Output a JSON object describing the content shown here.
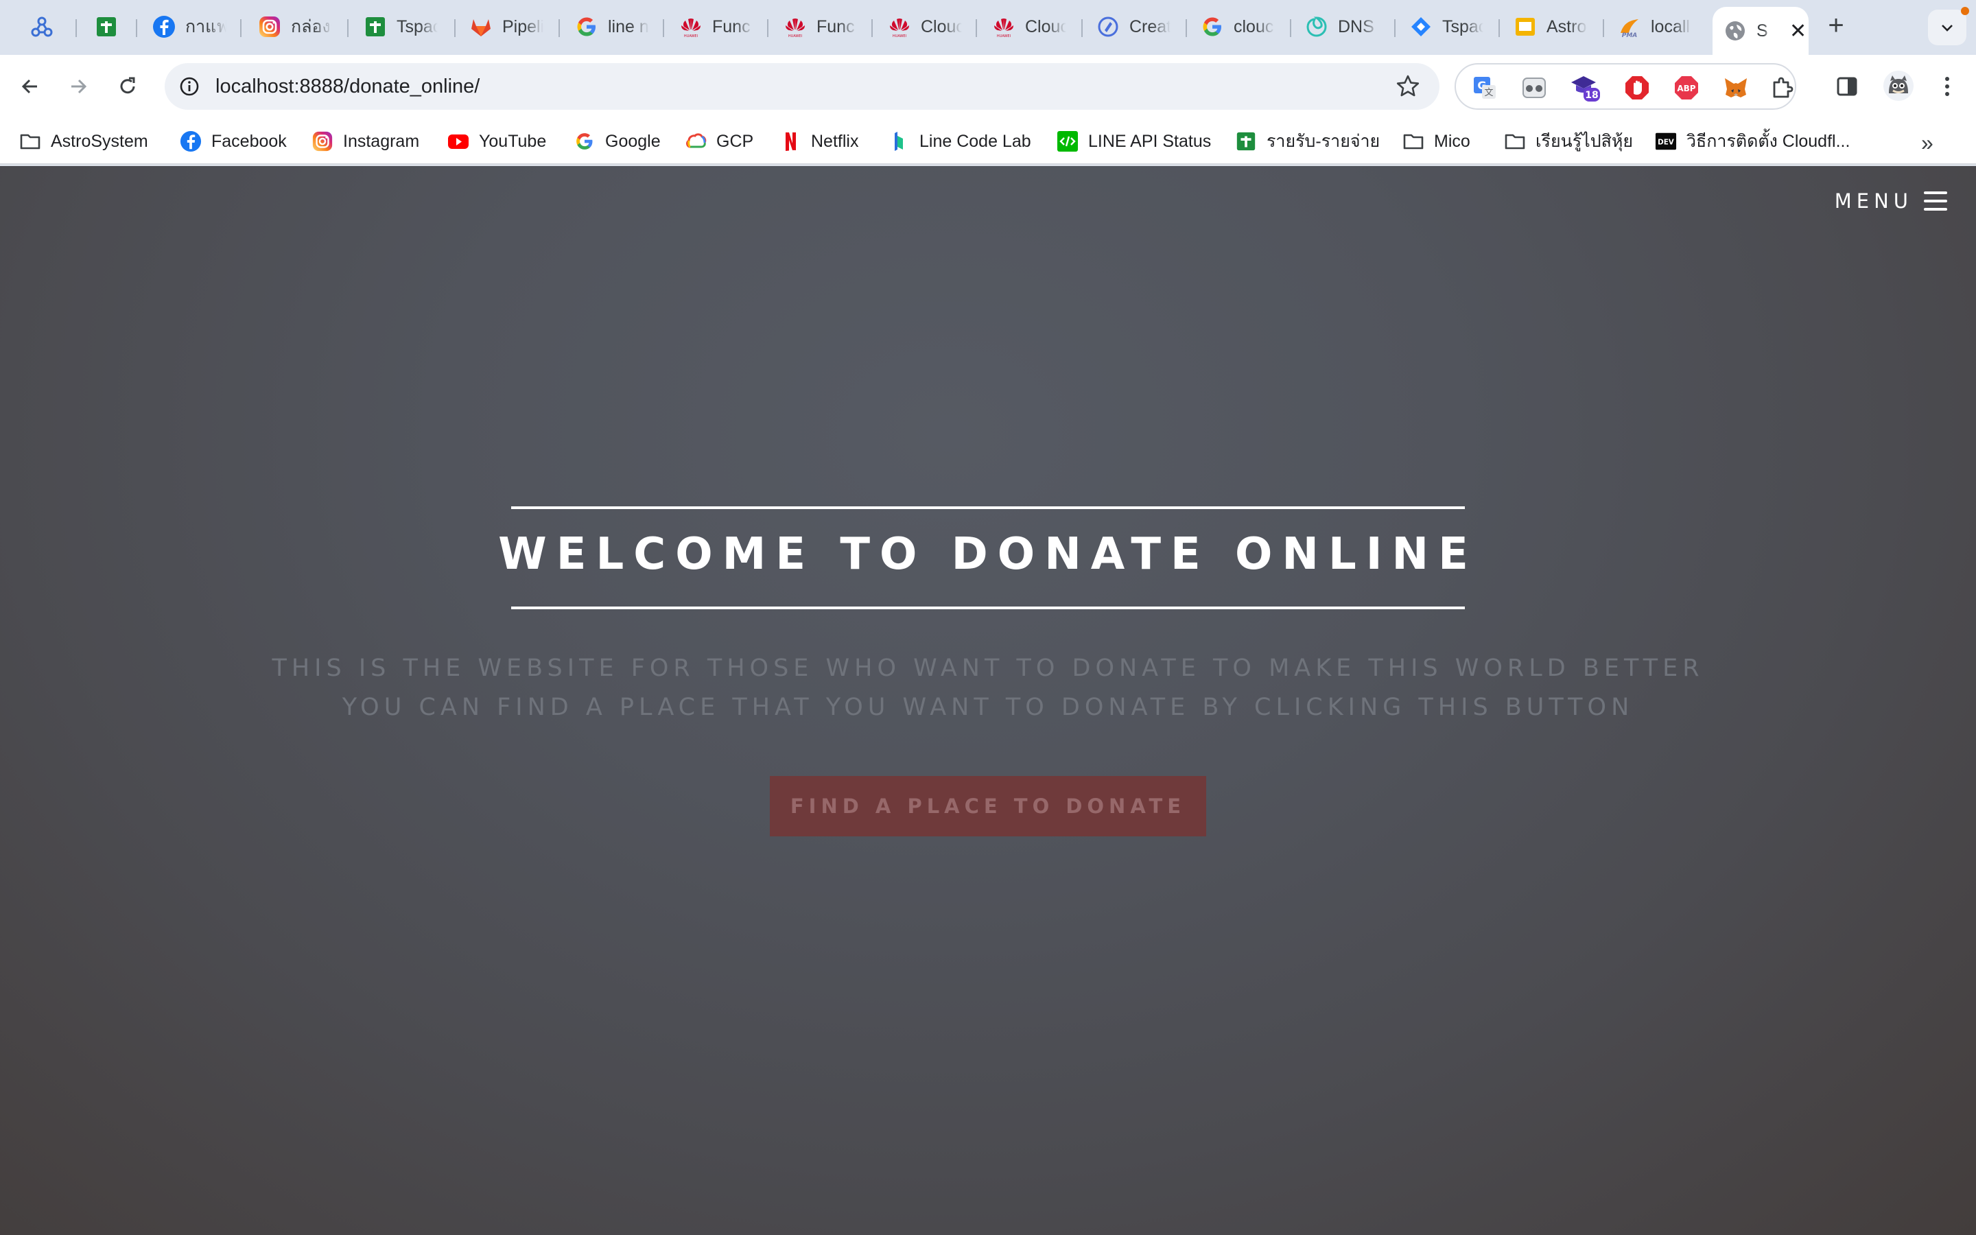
{
  "tabs": [
    {
      "icon": "network-icon",
      "title": ""
    },
    {
      "icon": "sheets-icon",
      "title": ""
    },
    {
      "icon": "facebook-icon",
      "title": "กาแฟ"
    },
    {
      "icon": "instagram-icon",
      "title": "กล่องร"
    },
    {
      "icon": "sheets-icon",
      "title": "Tspac"
    },
    {
      "icon": "gitlab-icon",
      "title": "Pipeli"
    },
    {
      "icon": "google-icon",
      "title": "line n"
    },
    {
      "icon": "huawei-icon",
      "title": "Func"
    },
    {
      "icon": "huawei-icon",
      "title": "Func"
    },
    {
      "icon": "huawei-icon",
      "title": "Clouc"
    },
    {
      "icon": "huawei-icon",
      "title": "Clouc"
    },
    {
      "icon": "create-icon",
      "title": "Creat"
    },
    {
      "icon": "google-icon",
      "title": "clouc"
    },
    {
      "icon": "dns-icon",
      "title": "DNS"
    },
    {
      "icon": "jira-icon",
      "title": "Tspac"
    },
    {
      "icon": "slides-icon",
      "title": "Astro"
    },
    {
      "icon": "phpmyadmin-icon",
      "title": "locall"
    },
    {
      "icon": "globe-icon",
      "title": "S",
      "active": true
    }
  ],
  "address_bar": {
    "url": "localhost:8888/donate_online/"
  },
  "extensions": [
    {
      "name": "translate-extension-icon"
    },
    {
      "name": "glasses-extension-icon"
    },
    {
      "name": "graduation-extension-icon",
      "badge": "18"
    },
    {
      "name": "adblock-stop-extension-icon"
    },
    {
      "name": "abp-extension-icon",
      "text": "ABP"
    },
    {
      "name": "metamask-extension-icon"
    },
    {
      "name": "puzzle-extensions-icon"
    }
  ],
  "bookmarks": [
    {
      "icon": "folder-icon",
      "label": "AstroSystem"
    },
    {
      "icon": "facebook-icon",
      "label": "Facebook"
    },
    {
      "icon": "instagram-icon",
      "label": "Instagram"
    },
    {
      "icon": "youtube-icon",
      "label": "YouTube"
    },
    {
      "icon": "google-icon",
      "label": "Google"
    },
    {
      "icon": "gcp-icon",
      "label": "GCP"
    },
    {
      "icon": "netflix-icon",
      "label": "Netflix"
    },
    {
      "icon": "linecodelab-icon",
      "label": "Line Code Lab"
    },
    {
      "icon": "line-api-icon",
      "label": "LINE API Status"
    },
    {
      "icon": "sheets-icon",
      "label": "รายรับ-รายจ่าย"
    },
    {
      "icon": "folder-icon",
      "label": "Mico"
    },
    {
      "icon": "folder-icon",
      "label": "เรียนรู้ไปสิหุ้ย"
    },
    {
      "icon": "dev-icon",
      "label": "วิธีการติดตั้ง Cloudfl...",
      "icon_text": "DEV"
    }
  ],
  "page": {
    "menu_label": "MENU",
    "title": "WELCOME TO DONATE ONLINE",
    "subtitle_line1": "THIS IS THE WEBSITE FOR THOSE WHO WANT TO DONATE TO MAKE THIS WORLD BETTER",
    "subtitle_line2": "YOU CAN FIND A PLACE THAT YOU WANT TO DONATE BY CLICKING THIS BUTTON",
    "cta_label": "FIND A PLACE TO DONATE"
  },
  "colors": {
    "tab_strip": "#dce3ee",
    "cta_background": "#6f3a3b",
    "cta_text": "#97686a",
    "subtitle_text": "#6f737b"
  }
}
